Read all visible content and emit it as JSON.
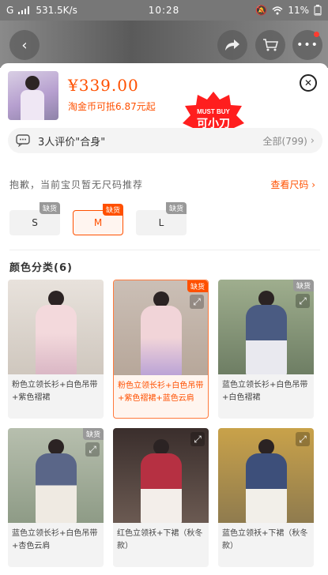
{
  "status": {
    "carrier": "G",
    "speed": "531.5K/s",
    "time": "10:28",
    "battery": "11%"
  },
  "product": {
    "price": "¥339.00",
    "coin_deal": "淘金币可抵6.87元起"
  },
  "badge": {
    "top": "MUST BUY",
    "main": "可小刀"
  },
  "reviews": {
    "text": "3人评价\"合身\"",
    "all": "全部(799)"
  },
  "size_hint": {
    "text": "抱歉，当前宝贝暂无尺码推荐",
    "link": "查看尺码"
  },
  "sizes": [
    {
      "label": "S",
      "tag": "缺货",
      "selected": false
    },
    {
      "label": "M",
      "tag": "缺货",
      "selected": true
    },
    {
      "label": "L",
      "tag": "缺货",
      "selected": false
    }
  ],
  "color_heading": "颜色分类(6)",
  "colors": [
    {
      "caption": "粉色立领长衫+白色吊带+紫色褶裙",
      "tag": "",
      "selected": false,
      "top": "#f3d9dc",
      "bottom": "#d9b6c4"
    },
    {
      "caption": "粉色立领长衫+白色吊带+紫色褶裙+蓝色云肩",
      "tag": "缺货",
      "selected": true,
      "top": "#f1d4d8",
      "bottom": "#b9a1d6"
    },
    {
      "caption": "蓝色立领长衫+白色吊带+白色褶裙",
      "tag": "缺货",
      "selected": false,
      "top": "#4a5b82",
      "bottom": "#e9e9ef"
    },
    {
      "caption": "蓝色立领长衫+白色吊带+杏色云肩",
      "tag": "缺货",
      "selected": false,
      "top": "#5a6688",
      "bottom": "#efeae2"
    },
    {
      "caption": "红色立领袄+下裙（秋冬款）",
      "tag": "",
      "selected": false,
      "top": "#b63042",
      "bottom": "#f3eeea"
    },
    {
      "caption": "蓝色立领袄+下裙（秋冬款）",
      "tag": "",
      "selected": false,
      "top": "#3d4f7a",
      "bottom": "#f2efe9"
    }
  ]
}
